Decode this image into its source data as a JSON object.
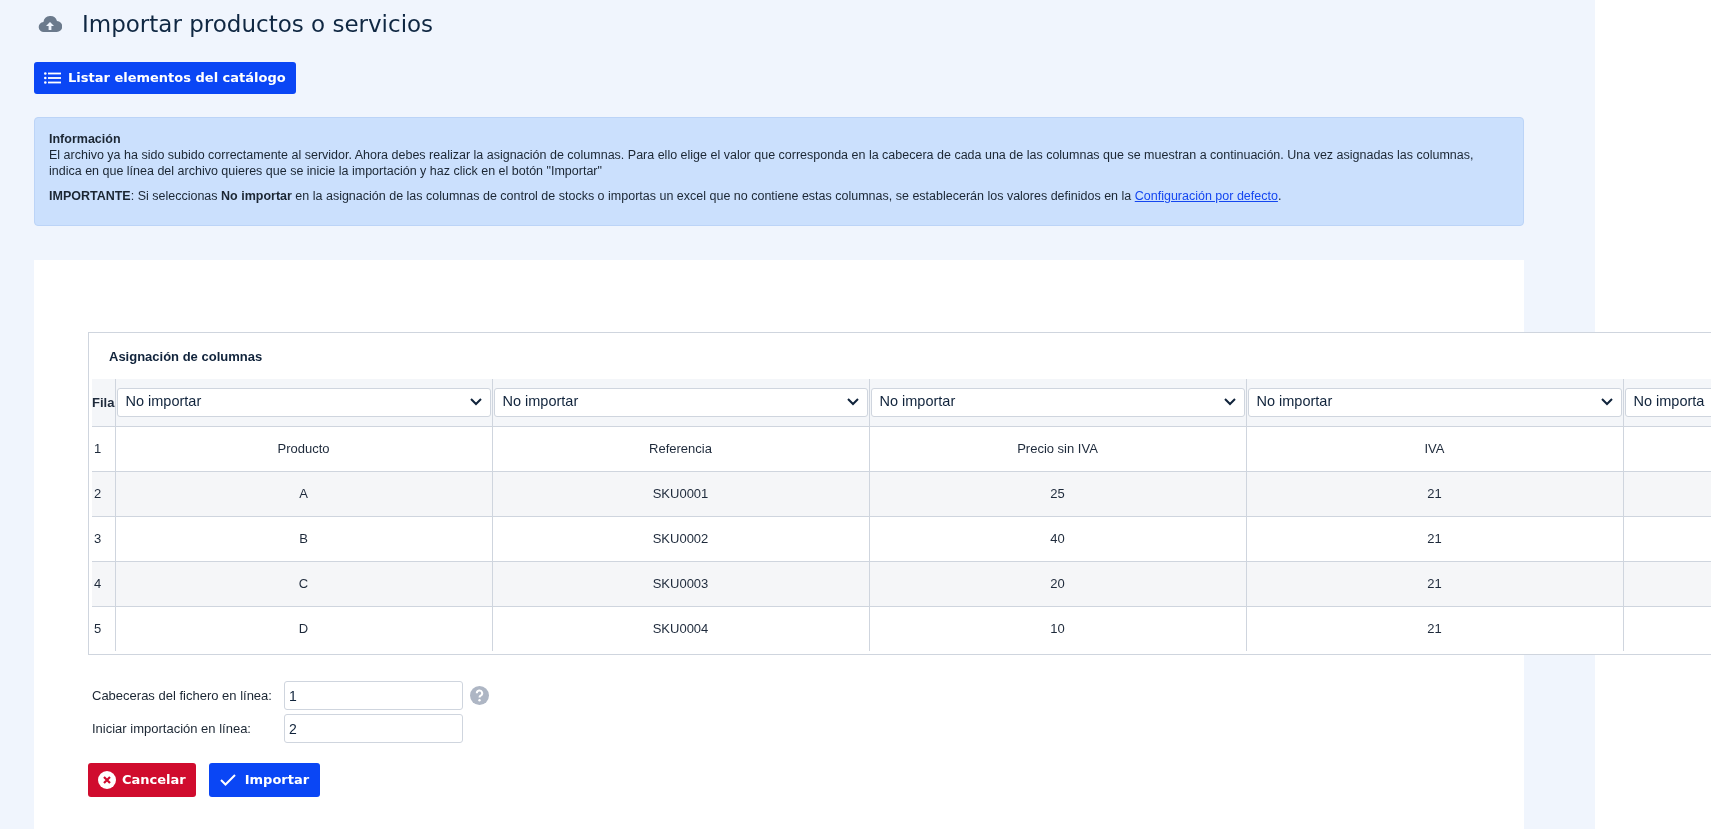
{
  "page": {
    "title": "Importar productos o servicios"
  },
  "toolbar": {
    "list_button": "Listar elementos del catálogo"
  },
  "info": {
    "heading": "Información",
    "paragraph": "El archivo ya ha sido subido correctamente al servidor. Ahora debes realizar la asignación de columnas. Para ello elige el valor que corresponda en la cabecera de cada una de las columnas que se muestran a continuación. Una vez asignadas las columnas, indica en que línea del archivo quieres que se inicie la importación y haz click en el botón \"Importar\"",
    "important": "**IMPORTANTE**: Si seleccionas **No importar** en la asignación de las columnas de control de stocks o importas un excel que no contiene estas columnas, se establecerán los valores definidos en la",
    "link": "Configuración por defecto",
    "after_link": "."
  },
  "mapping": {
    "title": "Asignación de columnas",
    "row_header": "Fila",
    "selects": [
      "No importar",
      "No importar",
      "No importar",
      "No importar",
      "No importa"
    ],
    "rows": [
      {
        "row": "1",
        "cells": [
          "Producto",
          "Referencia",
          "Precio sin IVA",
          "IVA"
        ]
      },
      {
        "row": "2",
        "cells": [
          "A",
          "SKU0001",
          "25",
          "21"
        ]
      },
      {
        "row": "3",
        "cells": [
          "B",
          "SKU0002",
          "40",
          "21"
        ]
      },
      {
        "row": "4",
        "cells": [
          "C",
          "SKU0003",
          "20",
          "21"
        ]
      },
      {
        "row": "5",
        "cells": [
          "D",
          "SKU0004",
          "10",
          "21"
        ]
      }
    ]
  },
  "form": {
    "fields": [
      {
        "label": "Cabeceras del fichero en línea:",
        "value": "1",
        "help": true
      },
      {
        "label": "Iniciar importación en línea:",
        "value": "2",
        "help": false
      }
    ]
  },
  "actions": [
    {
      "kind": "cancel",
      "label": "Cancelar"
    },
    {
      "kind": "submit",
      "label": "Importar"
    }
  ]
}
